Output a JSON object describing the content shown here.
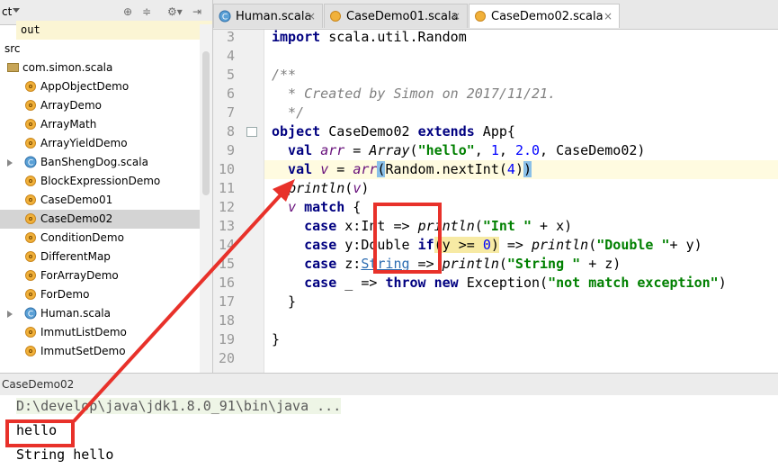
{
  "project_panel": {
    "title_fragment": "ct",
    "toolbar_icons": [
      "settings-target-icon",
      "collapse-icon",
      "gear-icon",
      "hide-icon"
    ],
    "tree": [
      {
        "label": "out",
        "type": "folder-out"
      },
      {
        "label": "src",
        "type": "folder"
      },
      {
        "label": "com.simon.scala",
        "type": "package"
      },
      {
        "label": "AppObjectDemo",
        "type": "object"
      },
      {
        "label": "ArrayDemo",
        "type": "object"
      },
      {
        "label": "ArrayMath",
        "type": "object"
      },
      {
        "label": "ArrayYieldDemo",
        "type": "object"
      },
      {
        "label": "BanShengDog.scala",
        "type": "class-file"
      },
      {
        "label": "BlockExpressionDemo",
        "type": "object"
      },
      {
        "label": "CaseDemo01",
        "type": "object"
      },
      {
        "label": "CaseDemo02",
        "type": "object",
        "selected": true
      },
      {
        "label": "ConditionDemo",
        "type": "object"
      },
      {
        "label": "DifferentMap",
        "type": "object"
      },
      {
        "label": "ForArrayDemo",
        "type": "object"
      },
      {
        "label": "ForDemo",
        "type": "object"
      },
      {
        "label": "Human.scala",
        "type": "class-file"
      },
      {
        "label": "ImmutListDemo",
        "type": "object"
      },
      {
        "label": "ImmutSetDemo",
        "type": "object"
      }
    ]
  },
  "tabs": [
    {
      "label": "Human.scala",
      "close": "×",
      "icon": "class-icon"
    },
    {
      "label": "CaseDemo01.scala",
      "close": "×",
      "icon": "object-icon"
    },
    {
      "label": "CaseDemo02.scala",
      "close": "×",
      "icon": "object-icon",
      "active": true
    }
  ],
  "editor": {
    "line_numbers": [
      "3",
      "4",
      "5",
      "6",
      "7",
      "8",
      "9",
      "10",
      "11",
      "12",
      "13",
      "14",
      "15",
      "16",
      "17",
      "18",
      "19",
      "20"
    ],
    "current_line": "10",
    "lines": {
      "l3a": "import",
      "l3b": " scala.util.Random",
      "l5": "/**",
      "l6": "  * Created by Simon on 2017/11/21.",
      "l7": "  */",
      "l8a": "object",
      "l8b": " CaseDemo02 ",
      "l8c": "extends",
      "l8d": " App{",
      "l9a": "  val",
      "l9b": " ",
      "l9c": "arr",
      "l9d": " = ",
      "l9e": "Array",
      "l9f": "(",
      "l9g": "\"hello\"",
      "l9h": ", ",
      "l9i": "1",
      "l9j": ", ",
      "l9k": "2.0",
      "l9l": ", CaseDemo02)",
      "l10a": "  val",
      "l10b": " ",
      "l10c": "v",
      "l10d": " = ",
      "l10e": "arr",
      "l10f": "(",
      "l10g": "Random.nextInt(",
      "l10h": "4",
      "l10i": ")",
      "l10j": ")",
      "l11a": "  ",
      "l11b": "println",
      "l11c": "(",
      "l11d": "v",
      "l11e": ")",
      "l12a": "  ",
      "l12b": "v",
      "l12c": " ",
      "l12d": "match",
      "l12e": " {",
      "l13a": "    case",
      "l13b": " x:Int => ",
      "l13c": "println",
      "l13d": "(",
      "l13e": "\"Int \"",
      "l13f": " + x)",
      "l14a": "    case",
      "l14b": " y:Double ",
      "l14c": "if",
      "l14d": "(y >= ",
      "l14e": "0",
      "l14f": ")",
      "l14g": " => ",
      "l14h": "println",
      "l14i": "(",
      "l14j": "\"Double \"",
      "l14k": "+ y)",
      "l15a": "    case",
      "l15b": " z:",
      "l15c": "String",
      "l15d": " => ",
      "l15e": "println",
      "l15f": "(",
      "l15g": "\"String \"",
      "l15h": " + z)",
      "l16a": "    case",
      "l16b": " _ => ",
      "l16c": "throw",
      "l16d": " ",
      "l16e": "new",
      "l16f": " Exception(",
      "l16g": "\"not match exception\"",
      "l16h": ")",
      "l17": "  }",
      "l19": "}"
    }
  },
  "run_panel": {
    "title": "CaseDemo02",
    "cmd": "D:\\develop\\java\\jdk1.8.0_91\\bin\\java ...",
    "out1": "hello",
    "out2": "String hello"
  },
  "colors": {
    "annotation": "#e8312a",
    "keyword": "#000080",
    "string": "#008000",
    "number": "#0000ff"
  }
}
